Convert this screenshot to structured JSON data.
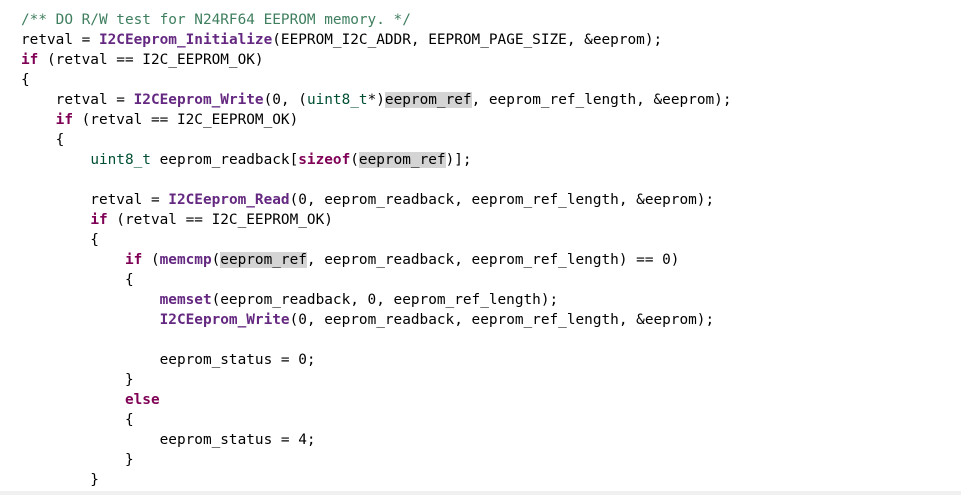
{
  "editor": {
    "lines": [
      [
        {
          "t": "/** DO R/W test for N24RF64 EEPROM memory. */",
          "s": "comment"
        }
      ],
      [
        {
          "t": "retval = ",
          "s": "plain"
        },
        {
          "t": "I2CEeprom_Initialize",
          "s": "fn"
        },
        {
          "t": "(EEPROM_I2C_ADDR, EEPROM_PAGE_SIZE, &eeprom);",
          "s": "plain"
        }
      ],
      [
        {
          "t": "if",
          "s": "kw"
        },
        {
          "t": " (retval == I2C_EEPROM_OK)",
          "s": "plain"
        }
      ],
      [
        {
          "t": "{",
          "s": "plain"
        }
      ],
      [
        {
          "t": "    retval = ",
          "s": "plain"
        },
        {
          "t": "I2CEeprom_Write",
          "s": "fn"
        },
        {
          "t": "(0, (",
          "s": "plain"
        },
        {
          "t": "uint8_t",
          "s": "type"
        },
        {
          "t": "*)",
          "s": "plain"
        },
        {
          "t": "eeprom_ref",
          "s": "hl"
        },
        {
          "t": ", eeprom_ref_length, &eeprom);",
          "s": "plain"
        }
      ],
      [
        {
          "t": "    ",
          "s": "plain"
        },
        {
          "t": "if",
          "s": "kw"
        },
        {
          "t": " (retval == I2C_EEPROM_OK)",
          "s": "plain"
        }
      ],
      [
        {
          "t": "    {",
          "s": "plain"
        }
      ],
      [
        {
          "t": "        ",
          "s": "plain"
        },
        {
          "t": "uint8_t",
          "s": "type"
        },
        {
          "t": " eeprom_readback[",
          "s": "plain"
        },
        {
          "t": "sizeof",
          "s": "kw"
        },
        {
          "t": "(",
          "s": "plain"
        },
        {
          "t": "eeprom_ref",
          "s": "hl"
        },
        {
          "t": ")];",
          "s": "plain"
        }
      ],
      [],
      [
        {
          "t": "        retval = ",
          "s": "plain"
        },
        {
          "t": "I2CEeprom_Read",
          "s": "fn"
        },
        {
          "t": "(0, eeprom_readback, eeprom_ref_length, &eeprom);",
          "s": "plain"
        }
      ],
      [
        {
          "t": "        ",
          "s": "plain"
        },
        {
          "t": "if",
          "s": "kw"
        },
        {
          "t": " (retval == I2C_EEPROM_OK)",
          "s": "plain"
        }
      ],
      [
        {
          "t": "        {",
          "s": "plain"
        }
      ],
      [
        {
          "t": "            ",
          "s": "plain"
        },
        {
          "t": "if",
          "s": "kw"
        },
        {
          "t": " (",
          "s": "plain"
        },
        {
          "t": "memcmp",
          "s": "fn"
        },
        {
          "t": "(",
          "s": "plain"
        },
        {
          "t": "eeprom_ref",
          "s": "hl"
        },
        {
          "t": ", eeprom_readback, eeprom_ref_length) == 0)",
          "s": "plain"
        }
      ],
      [
        {
          "t": "            {",
          "s": "plain"
        }
      ],
      [
        {
          "t": "                ",
          "s": "plain"
        },
        {
          "t": "memset",
          "s": "fn"
        },
        {
          "t": "(eeprom_readback, 0, eeprom_ref_length);",
          "s": "plain"
        }
      ],
      [
        {
          "t": "                ",
          "s": "plain"
        },
        {
          "t": "I2CEeprom_Write",
          "s": "fn"
        },
        {
          "t": "(0, eeprom_readback, eeprom_ref_length, &eeprom);",
          "s": "plain"
        }
      ],
      [],
      [
        {
          "t": "                eeprom_status = 0;",
          "s": "plain"
        }
      ],
      [
        {
          "t": "            }",
          "s": "plain"
        }
      ],
      [
        {
          "t": "            ",
          "s": "plain"
        },
        {
          "t": "else",
          "s": "kw"
        }
      ],
      [
        {
          "t": "            {",
          "s": "plain"
        }
      ],
      [
        {
          "t": "                eeprom_status = 4;",
          "s": "plain"
        }
      ],
      [
        {
          "t": "            }",
          "s": "plain"
        }
      ],
      [
        {
          "t": "        }",
          "s": "plain"
        }
      ]
    ]
  },
  "colors": {
    "comment": "#3f7f5f",
    "keyword": "#7f0055",
    "type": "#005032",
    "function": "#642880",
    "highlight": "#d4d4d4"
  }
}
